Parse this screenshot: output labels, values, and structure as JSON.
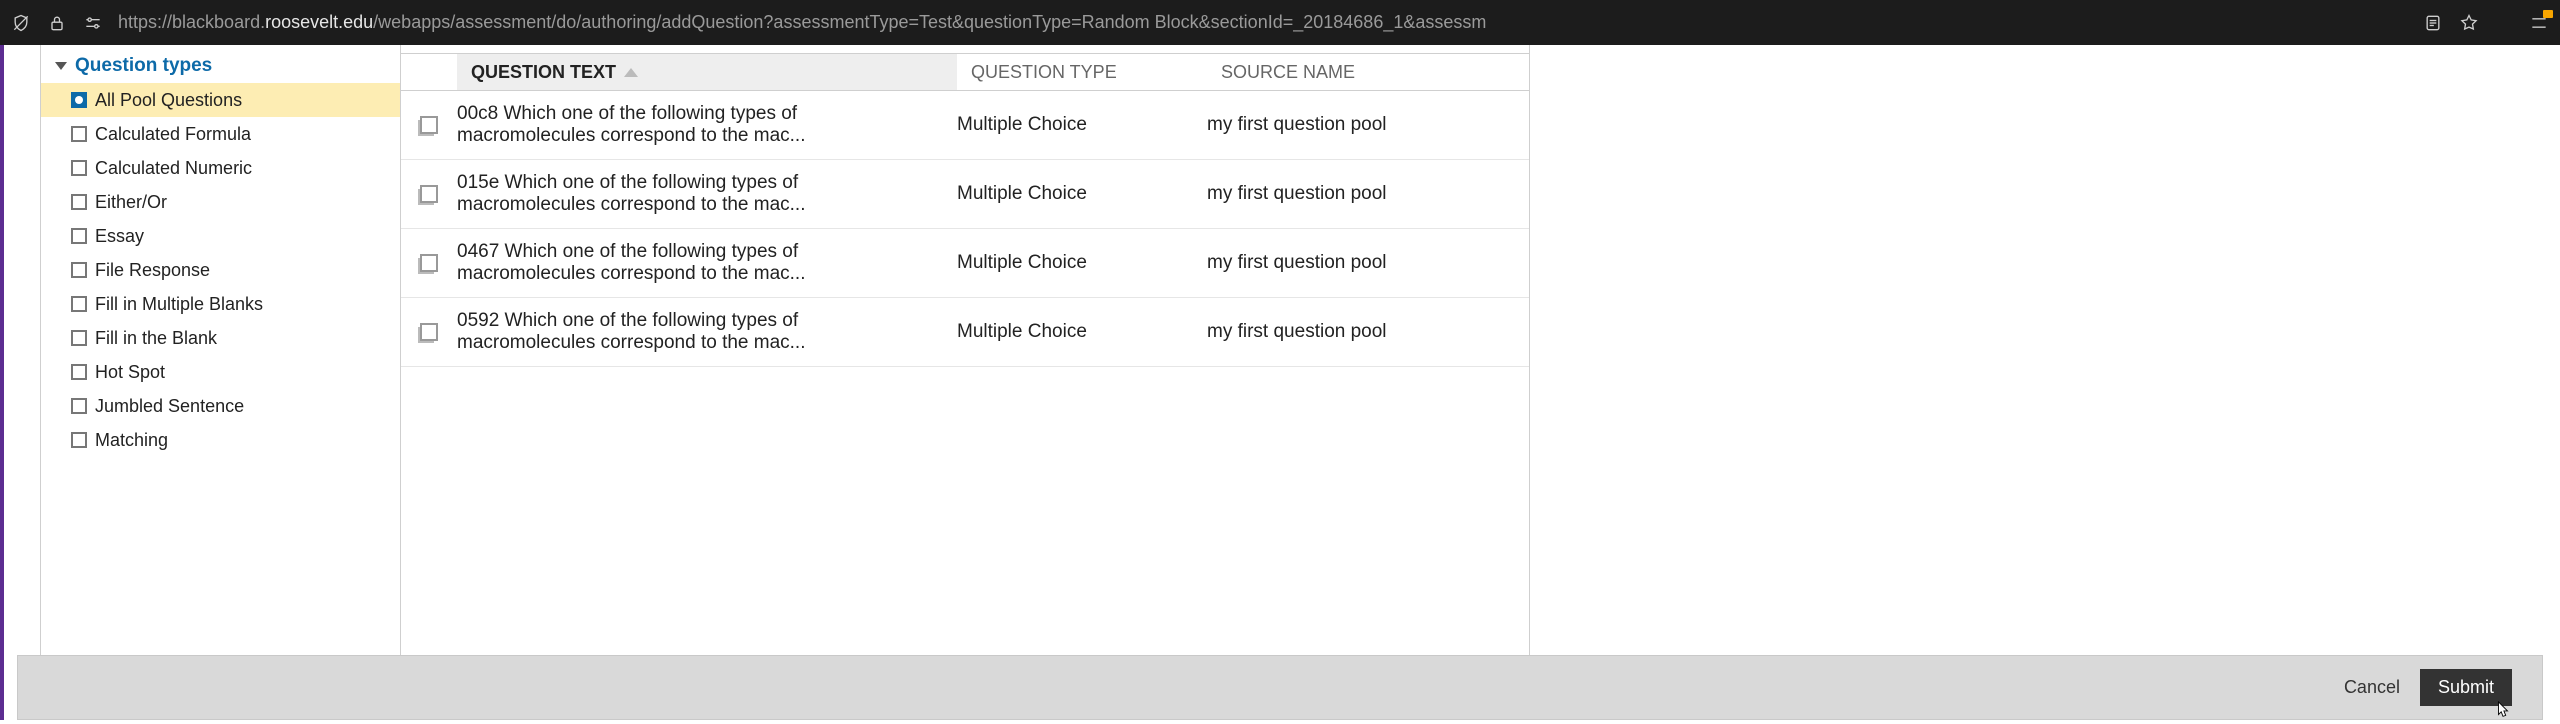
{
  "browser": {
    "url_prefix": "https://blackboard.",
    "url_domain": "roosevelt.edu",
    "url_path": "/webapps/assessment/do/authoring/addQuestion?assessmentType=Test&questionType=Random Block&sectionId=_20184686_1&assessm"
  },
  "sidebar": {
    "heading": "Question types",
    "items": [
      {
        "label": "All Pool Questions",
        "selected": true,
        "all": true
      },
      {
        "label": "Calculated Formula"
      },
      {
        "label": "Calculated Numeric"
      },
      {
        "label": "Either/Or"
      },
      {
        "label": "Essay"
      },
      {
        "label": "File Response"
      },
      {
        "label": "Fill in Multiple Blanks"
      },
      {
        "label": "Fill in the Blank"
      },
      {
        "label": "Hot Spot"
      },
      {
        "label": "Jumbled Sentence"
      },
      {
        "label": "Matching"
      }
    ]
  },
  "table": {
    "headers": {
      "question_text": "QUESTION TEXT",
      "question_type": "QUESTION TYPE",
      "source_name": "SOURCE NAME"
    },
    "rows": [
      {
        "text": "00c8 Which one of the following types of macromolecules correspond to the mac...",
        "type": "Multiple Choice",
        "source": "my first question pool"
      },
      {
        "text": "015e Which one of the following types of macromolecules correspond to the mac...",
        "type": "Multiple Choice",
        "source": "my first question pool"
      },
      {
        "text": "0467 Which one of the following types of macromolecules correspond to the mac...",
        "type": "Multiple Choice",
        "source": "my first question pool"
      },
      {
        "text": "0592 Which one of the following types of macromolecules correspond to the mac...",
        "type": "Multiple Choice",
        "source": "my first question pool"
      }
    ]
  },
  "footer": {
    "cancel": "Cancel",
    "submit": "Submit"
  }
}
